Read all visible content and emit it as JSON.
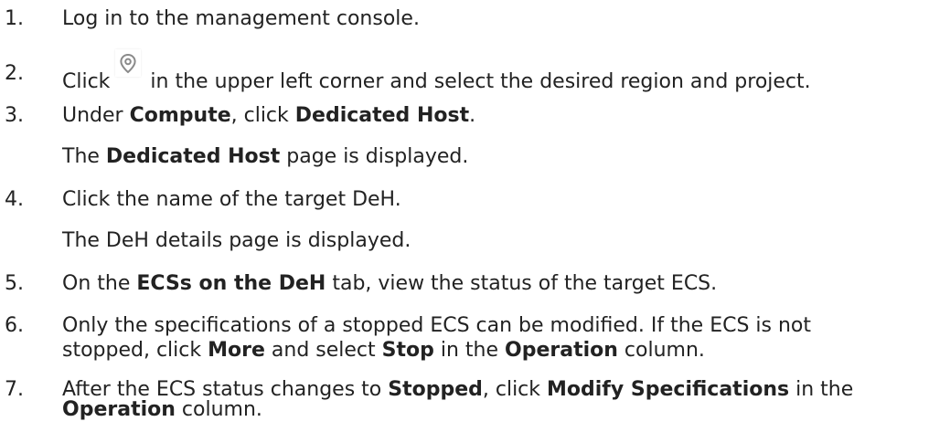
{
  "steps": [
    {
      "num": "1.",
      "text": "Log in to the management console."
    },
    {
      "num": "2.",
      "before": "Click",
      "icon": "location-pin-icon",
      "after": "in the upper left corner and select the desired region and project."
    },
    {
      "num": "3.",
      "a": "Under ",
      "b1": "Compute",
      "c": ", click ",
      "b2": "Dedicated Host",
      "d": ".",
      "sub_a": "The ",
      "sub_b": "Dedicated Host",
      "sub_c": " page is displayed."
    },
    {
      "num": "4.",
      "text": "Click the name of the target DeH.",
      "sub": "The DeH details page is displayed."
    },
    {
      "num": "5.",
      "a": "On the ",
      "b1": "ECSs on the DeH",
      "c": " tab, view the status of the target ECS."
    },
    {
      "num": "6.",
      "line1": "Only the specifications of a stopped ECS can be modified. If the ECS is not",
      "l2a": "stopped, click ",
      "l2b1": "More",
      "l2c": " and select ",
      "l2b2": "Stop",
      "l2d": " in the ",
      "l2b3": "Operation",
      "l2e": " column."
    },
    {
      "num": "7.",
      "a": "After the ECS status changes to ",
      "b1": "Stopped",
      "c": ", click ",
      "b2": "Modify Specifications",
      "d": " in the",
      "l2b": "Operation",
      "l2c": " column."
    }
  ]
}
